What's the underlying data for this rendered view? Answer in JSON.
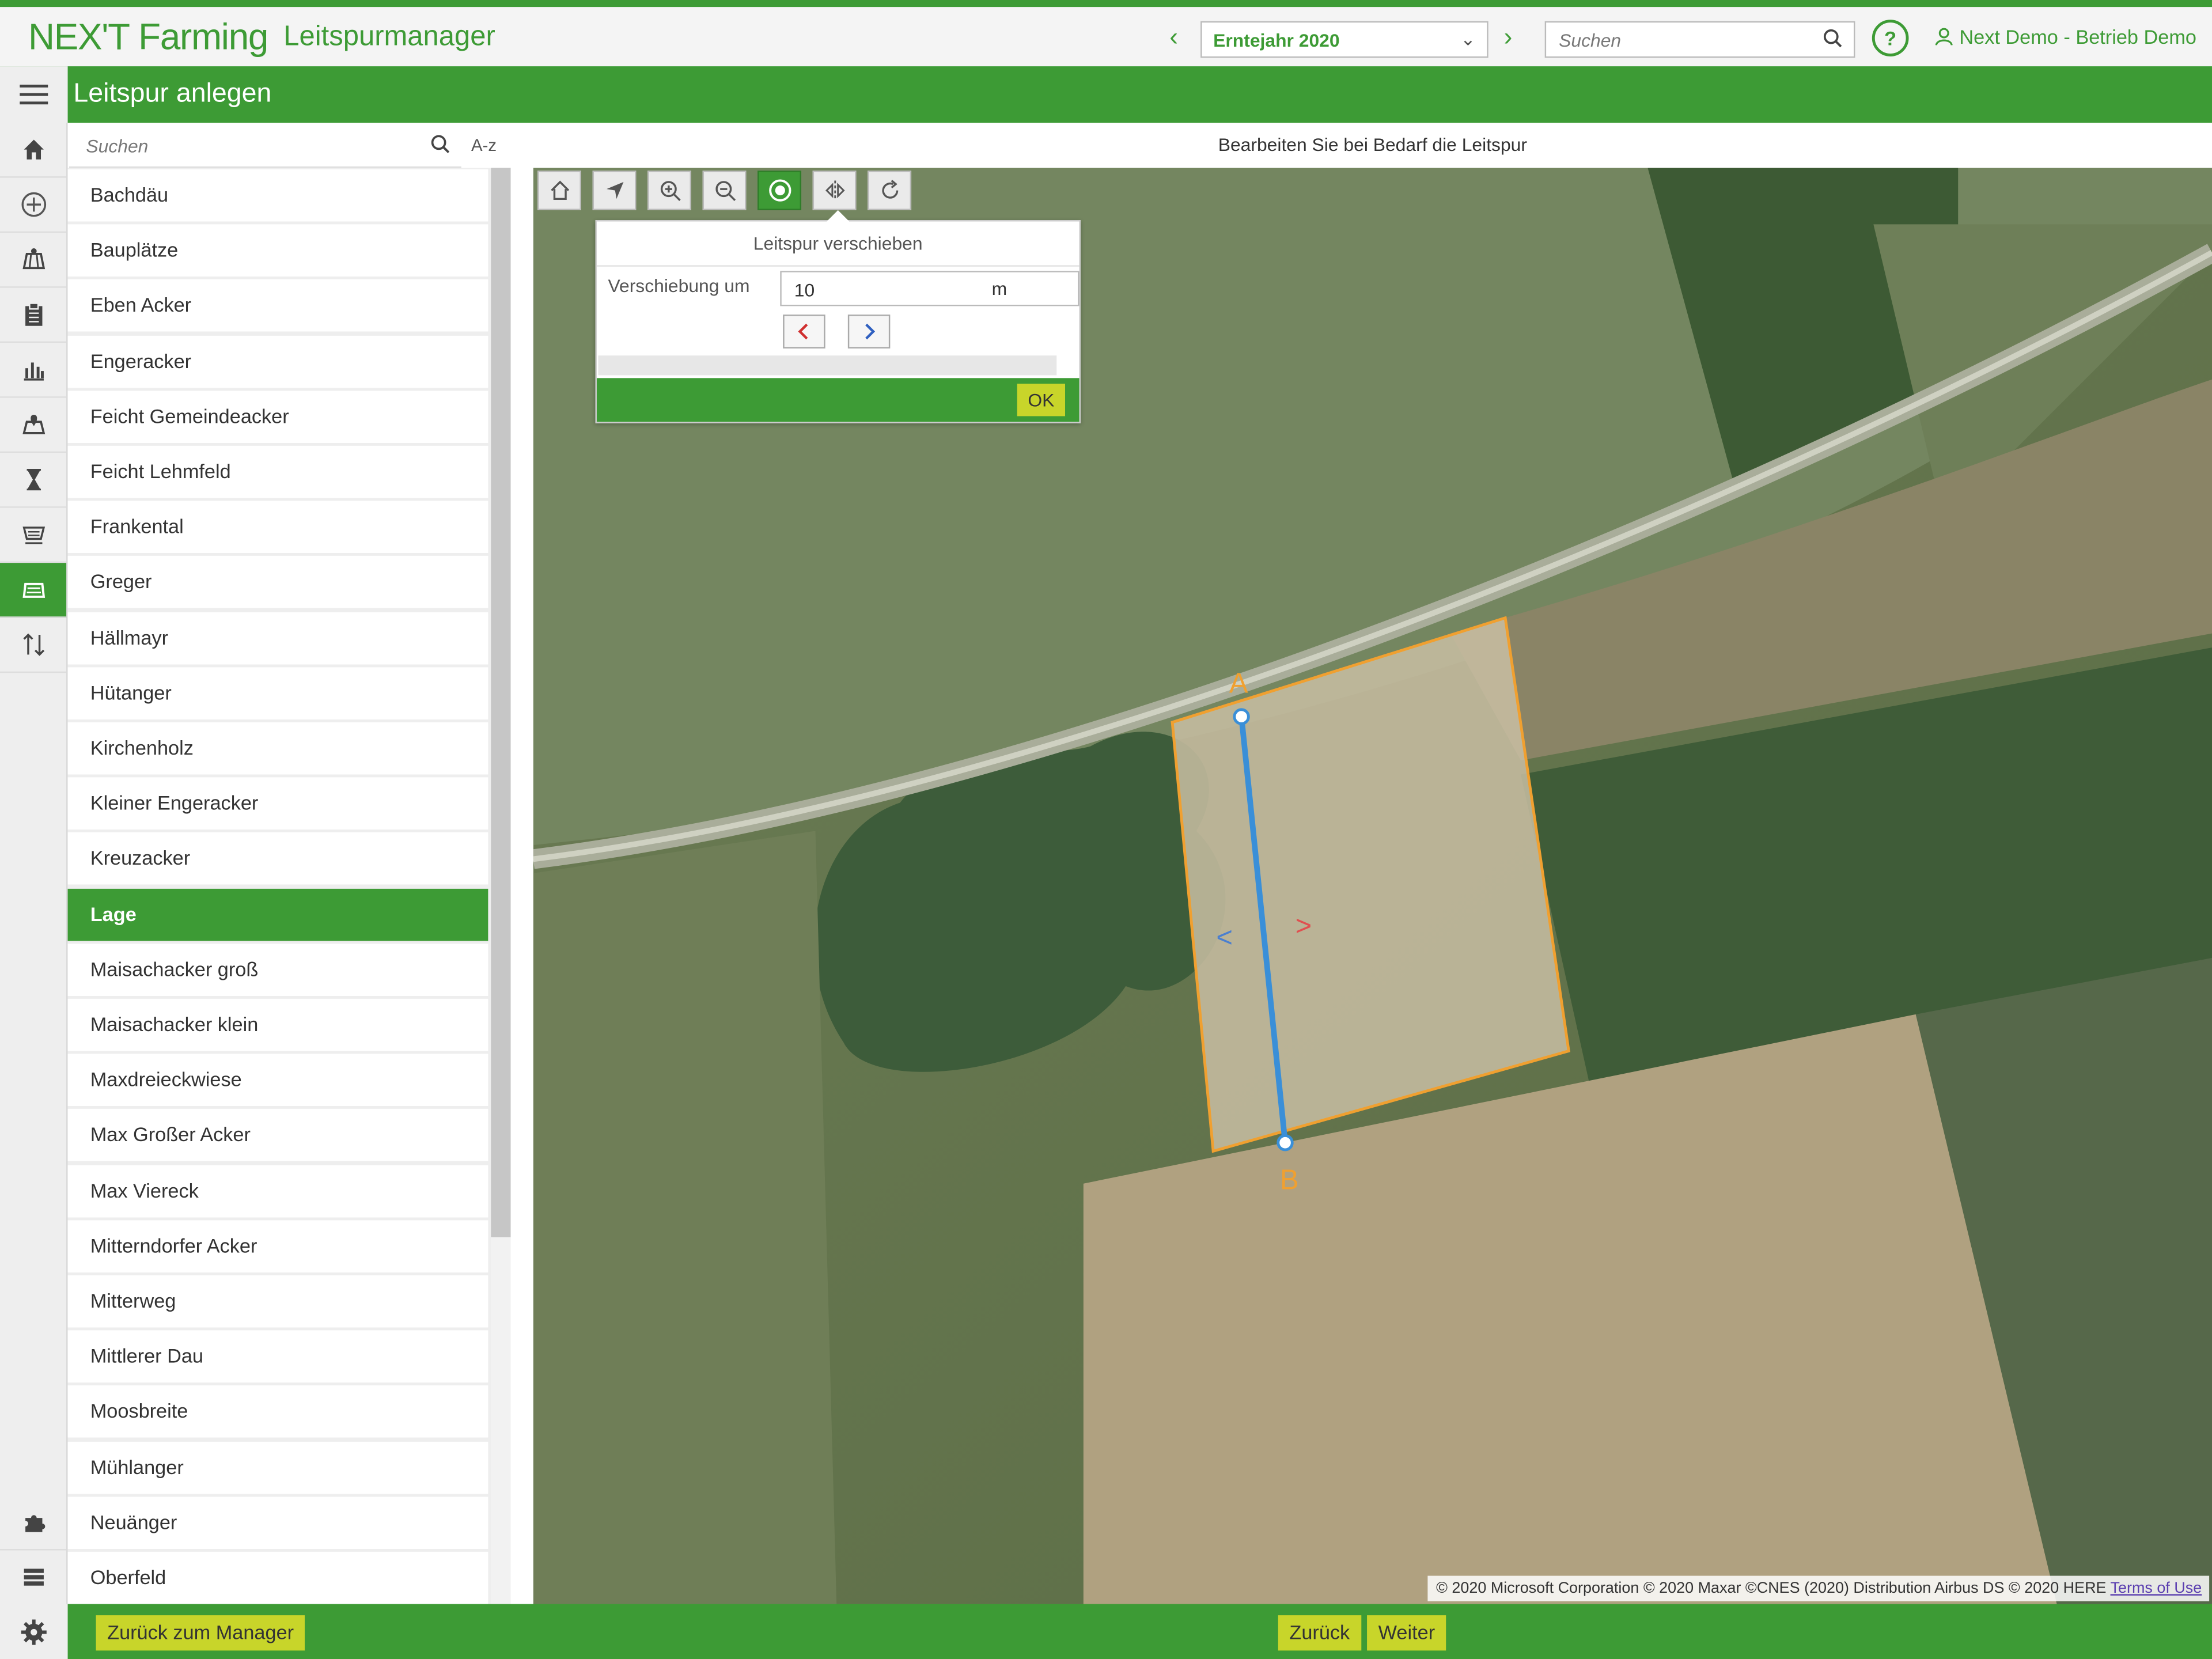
{
  "header": {
    "logo": "NEX'T Farming",
    "app_name": "Leitspurmanager",
    "prev_icon": "chevron-left-icon",
    "next_icon": "chevron-right-icon",
    "year_select": "Erntejahr 2020",
    "search_placeholder": "Suchen",
    "help_icon": "?",
    "user": "Next Demo - Betrieb Demo"
  },
  "titlebar": {
    "title": "Leitspur anlegen"
  },
  "sidebar": {
    "icons": [
      "home-icon",
      "add-circle-icon",
      "field-map-icon",
      "clipboard-icon",
      "bar-chart-icon",
      "map-pin-icon",
      "hourglass-icon",
      "machine-icon",
      "guidance-icon",
      "transfer-icon",
      "puzzle-icon",
      "list-icon",
      "gear-icon"
    ]
  },
  "list": {
    "search_placeholder": "Suchen",
    "sort_label": "A-z",
    "selected_index": 13,
    "items": [
      "Bachdäu",
      "Bauplätze",
      "Eben Acker",
      "Engeracker",
      "Feicht Gemeindeacker",
      "Feicht Lehmfeld",
      "Frankental",
      "Greger",
      "Hällmayr",
      "Hütanger",
      "Kirchenholz",
      "Kleiner Engeracker",
      "Kreuzacker",
      "Lage",
      "Maisachacker groß",
      "Maisachacker klein",
      "Maxdreieckwiese",
      "Max Großer Acker",
      "Max Viereck",
      "Mitterndorfer Acker",
      "Mitterweg",
      "Mittlerer Dau",
      "Moosbreite",
      "Mühlanger",
      "Neuänger",
      "Oberfeld"
    ]
  },
  "content": {
    "hint": "Bearbeiten Sie bei Bedarf die Leitspur"
  },
  "map_tools": [
    "home-icon",
    "locate-arrow-icon",
    "zoom-in-icon",
    "zoom-out-icon",
    "target-icon",
    "mirror-icon",
    "rotate-icon"
  ],
  "popup": {
    "title": "Leitspur verschieben",
    "label": "Verschiebung um",
    "value": "10",
    "unit": "m",
    "ok": "OK"
  },
  "map": {
    "point_a": "A",
    "point_b": "B",
    "shift_left": "<",
    "shift_right": ">",
    "copyright": "© 2020 Microsoft Corporation © 2020 Maxar ©CNES (2020) Distribution Airbus DS © 2020 HERE",
    "terms": "Terms of Use"
  },
  "footer": {
    "back_to_manager": "Zurück zum Manager",
    "back": "Zurück",
    "next": "Weiter"
  },
  "colors": {
    "brand_green": "#3d9b35",
    "button_yellow": "#c8d52a",
    "track_line": "#3a8fd8",
    "field_outline": "#f0a030"
  }
}
